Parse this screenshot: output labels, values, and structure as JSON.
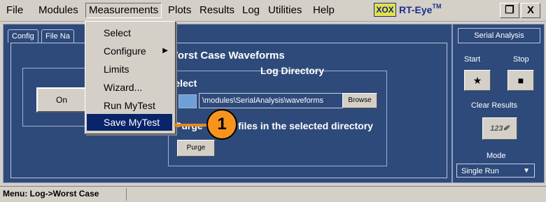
{
  "menubar": {
    "items": [
      "File",
      "Modules",
      "Measurements",
      "Plots",
      "Results",
      "Log",
      "Utilities",
      "Help"
    ],
    "brand_logo": "XOX",
    "brand_name": "RT-Eye",
    "brand_mark": "TM",
    "window_restore_label": "❐",
    "window_close_label": "X"
  },
  "tabs": {
    "config": "Config",
    "file_name": "File Na"
  },
  "main": {
    "on_button": "On",
    "worst_case_heading": "Worst Case Waveforms",
    "log_directory_label": "Log Directory",
    "select_label": "Select",
    "path_value": "\\modules\\SerialAnalysis\\waveforms",
    "browse_button": "Browse",
    "purge_text": "Purge",
    "purge_suffix": "files in the selected directory",
    "purge_button": "Purge"
  },
  "dropdown": {
    "items": [
      {
        "label": "Select"
      },
      {
        "label": "Configure",
        "submenu": true
      },
      {
        "label": "Limits"
      },
      {
        "label": "Wizard..."
      },
      {
        "label": "Run MyTest"
      },
      {
        "label": "Save MyTest",
        "highlighted": true
      }
    ],
    "submenu_arrow": "▶"
  },
  "callout": {
    "number": "1",
    "color": "#f7941e"
  },
  "side": {
    "title": "Serial Analysis",
    "start_label": "Start",
    "stop_label": "Stop",
    "run_icon": "★",
    "stop_icon": "■",
    "clear_results_label": "Clear Results",
    "clear_results_icon": "123✐",
    "mode_label": "Mode",
    "mode_value": "Single Run",
    "mode_caret": "▼"
  },
  "status": {
    "text": "Menu: Log->Worst Case"
  },
  "colors": {
    "panel": "#2e4a7a",
    "highlight": "#0a246a",
    "chrome": "#d4d0c8"
  }
}
